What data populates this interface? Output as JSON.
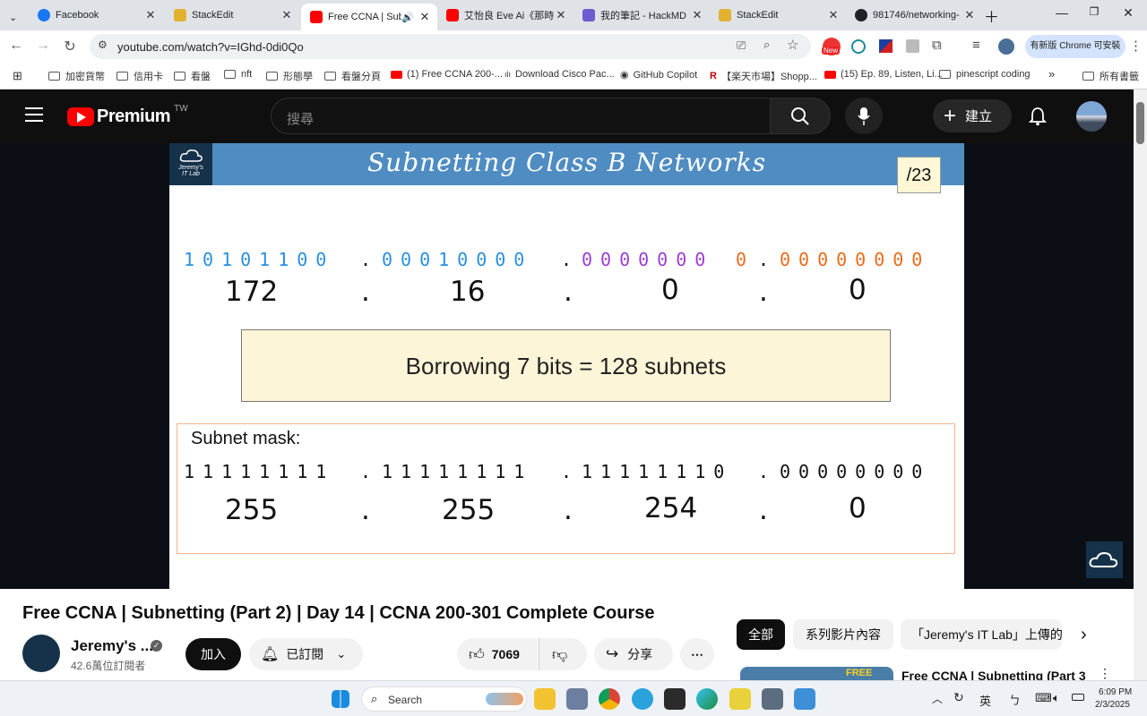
{
  "browser": {
    "tabs": [
      {
        "title": "Facebook",
        "color": "#1877f2"
      },
      {
        "title": "StackEdit",
        "color": "#e2b130"
      },
      {
        "title": "Free CCNA | Subr",
        "color": "#ff0000"
      },
      {
        "title": "艾怡良 Eve Ai《那時",
        "color": "#ff0000"
      },
      {
        "title": "我的筆記 - HackMD",
        "color": "#6d5bd0"
      },
      {
        "title": "StackEdit",
        "color": "#e2b130"
      },
      {
        "title": "981746/networking-",
        "color": "#1f2328"
      }
    ],
    "url": "youtube.com/watch?v=IGhd-0di0Qo",
    "update_button": "有新版 Chrome 可安裝",
    "new_badge": "New",
    "bookmarks": [
      "加密貨幣",
      "信用卡",
      "看盤",
      "nft",
      "形態學",
      "看盤分頁",
      "(1) Free CCNA 200-...",
      "Download Cisco Pac...",
      "GitHub Copilot",
      "【楽天市場】Shopp...",
      "(15) Ep. 89, Listen, Li...",
      "pinescript coding"
    ],
    "all_bookmarks": "所有書籤"
  },
  "youtube": {
    "logo_text": "Premium",
    "region": "TW",
    "search_placeholder": "搜尋",
    "create_label": "建立"
  },
  "slide": {
    "title": "Subnetting Class B Networks",
    "prefix": "/23",
    "logo_line1": "Jeremy's",
    "logo_line2": "IT Lab",
    "address_bits": {
      "o1": "10101100",
      "o2": "00010000",
      "o3_purple": "0000000",
      "o3_orange": "0",
      "o4": "00000000"
    },
    "address_decimal": [
      "172",
      "16",
      "0",
      "0"
    ],
    "dot": ".",
    "box_text": "Borrowing 7 bits = 128 subnets",
    "mask_label": "Subnet mask:",
    "mask_bits": [
      "11111111",
      "11111111",
      "11111110",
      "00000000"
    ],
    "mask_decimal": [
      "255",
      "255",
      "254",
      "0"
    ],
    "colors": {
      "blue": "#2a8fe0",
      "purple": "#9b3fd6",
      "orange": "#ee6a1a",
      "header": "#4f8cc2"
    }
  },
  "video_info": {
    "title": "Free CCNA | Subnetting (Part 2) | Day 14 | CCNA 200-301 Complete Course",
    "channel": "Jeremy's ...",
    "subscribers": "42.6萬位訂閱者",
    "join": "加入",
    "subscribed": "已訂閱",
    "likes": "7069",
    "share": "分享",
    "filters": [
      "全部",
      "系列影片內容",
      "「Jeremy's IT Lab」上傳的"
    ],
    "next_video": "Free CCNA | Subnetting (Part 3 -",
    "thumb_badge": "FREE"
  },
  "taskbar": {
    "search": "Search",
    "ime": "英",
    "time": "6:09 PM",
    "date": "2/3/2025"
  }
}
